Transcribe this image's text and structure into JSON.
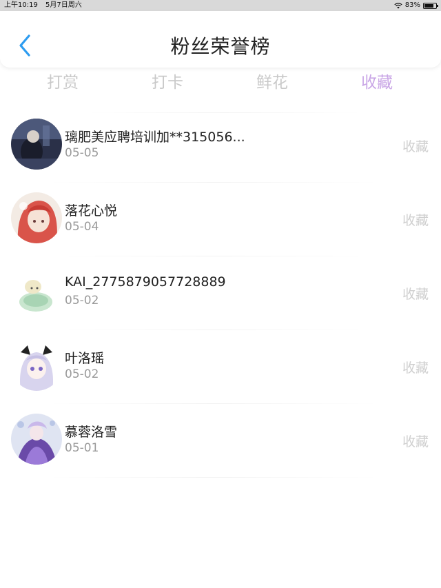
{
  "status_bar": {
    "time": "上午10:19",
    "date": "5月7日周六",
    "battery_percent": "83%",
    "battery_level": 0.83
  },
  "header": {
    "back_icon": "chevron-left-icon",
    "title": "粉丝荣誉榜",
    "accent_color": "#2d9cf0"
  },
  "tabs": [
    {
      "label": "打赏",
      "active": false
    },
    {
      "label": "打卡",
      "active": false
    },
    {
      "label": "鲜花",
      "active": false
    },
    {
      "label": "收藏",
      "active": true
    }
  ],
  "active_tab_color": "#c9a6e6",
  "fans": [
    {
      "name": "璃肥美应聘培训加**315056...",
      "date": "05-05",
      "type": "收藏"
    },
    {
      "name": "落花心悦",
      "date": "05-04",
      "type": "收藏"
    },
    {
      "name": "KAI_2775879057728889",
      "date": "05-02",
      "type": "收藏"
    },
    {
      "name": "叶洛瑶",
      "date": "05-02",
      "type": "收藏"
    },
    {
      "name": "慕蓉洛雪",
      "date": "05-01",
      "type": "收藏"
    }
  ]
}
